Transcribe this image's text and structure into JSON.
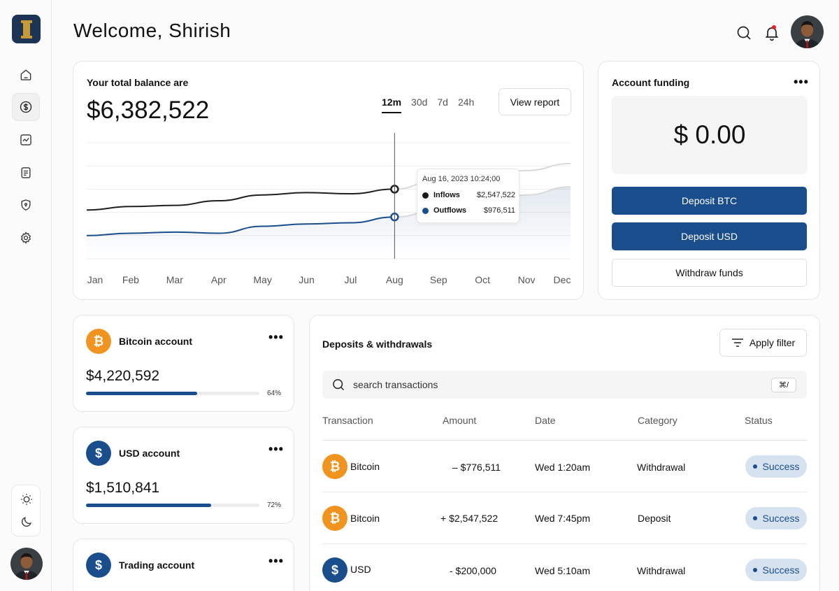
{
  "colors": {
    "primary": "#1a4d8c",
    "bitcoin": "#f0941f",
    "usd": "#1a4d8c",
    "status_bg": "#d6e2ef"
  },
  "user": {
    "welcome": "Welcome, Shirish"
  },
  "sidebar": {
    "logo": "I-logo",
    "items": [
      {
        "icon": "home-icon"
      },
      {
        "icon": "dollar-icon",
        "active": true
      },
      {
        "icon": "trend-icon"
      },
      {
        "icon": "document-icon"
      },
      {
        "icon": "shield-icon"
      },
      {
        "icon": "gear-icon"
      }
    ],
    "theme": [
      "sun-icon",
      "moon-icon"
    ]
  },
  "header": {
    "icons": [
      "search-icon",
      "bell-icon"
    ]
  },
  "balance": {
    "label": "Your total balance are",
    "amount": "$6,382,522",
    "ranges": [
      "12m",
      "30d",
      "7d",
      "24h"
    ],
    "active_range": "12m",
    "view_report": "View report"
  },
  "chart_data": {
    "type": "line",
    "categories": [
      "Jan",
      "Feb",
      "Mar",
      "Apr",
      "May",
      "Jun",
      "Jul",
      "Aug",
      "Sep",
      "Oct",
      "Nov",
      "Dec"
    ],
    "series": [
      {
        "name": "Inflows",
        "values": [
          0.42,
          0.45,
          0.46,
          0.5,
          0.55,
          0.57,
          0.56,
          0.6,
          0.68,
          0.7,
          0.76,
          0.82
        ],
        "projected_from_index": 7
      },
      {
        "name": "Outflows",
        "values": [
          0.2,
          0.22,
          0.23,
          0.22,
          0.28,
          0.3,
          0.31,
          0.36,
          0.42,
          0.48,
          0.55,
          0.62
        ],
        "projected_from_index": 7
      }
    ],
    "tooltip": {
      "date": "Aug 16, 2023 10:24;00",
      "rows": [
        {
          "name": "Inflows",
          "value": "$2,547,522"
        },
        {
          "name": "Outflows",
          "value": "$976,511"
        }
      ]
    },
    "grid": true
  },
  "funding": {
    "title": "Account funding",
    "amount": "$ 0.00",
    "deposit_btc": "Deposit BTC",
    "deposit_usd": "Deposit USD",
    "withdraw": "Withdraw funds"
  },
  "accounts": [
    {
      "name": "Bitcoin account",
      "balance": "$4,220,592",
      "percent": "64%",
      "fraction": 0.64,
      "icon": "bitcoin-icon",
      "glyph": "₿"
    },
    {
      "name": "USD account",
      "balance": "$1,510,841",
      "percent": "72%",
      "fraction": 0.72,
      "icon": "dollar-icon",
      "glyph": "$"
    },
    {
      "name": "Trading account",
      "icon": "dollar-icon",
      "glyph": "$"
    }
  ],
  "transactions": {
    "title": "Deposits & withdrawals",
    "filter": "Apply filter",
    "search_placeholder": "search transactions",
    "shortcut": "⌘/",
    "columns": [
      "Transaction",
      "Amount",
      "Date",
      "Category",
      "Status"
    ],
    "rows": [
      {
        "name": "Bitcoin",
        "amount": "– $776,511",
        "date": "Wed 1:20am",
        "category": "Withdrawal",
        "status": "Success",
        "glyph": "₿",
        "kind": "bitcoin"
      },
      {
        "name": "Bitcoin",
        "amount": "+ $2,547,522",
        "date": "Wed 7:45pm",
        "category": "Deposit",
        "status": "Success",
        "glyph": "₿",
        "kind": "bitcoin"
      },
      {
        "name": "USD",
        "amount": "- $200,000",
        "date": "Wed 5:10am",
        "category": "Withdrawal",
        "status": "Success",
        "glyph": "$",
        "kind": "usd"
      }
    ]
  }
}
